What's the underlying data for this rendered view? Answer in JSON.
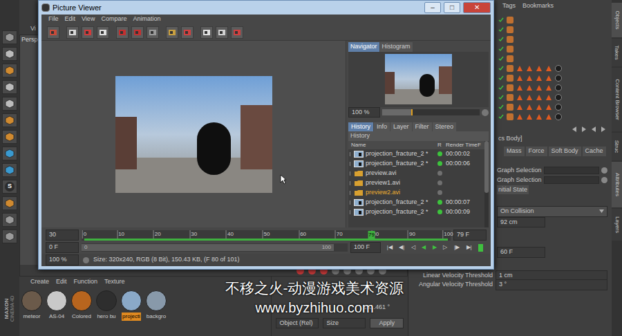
{
  "viewer": {
    "title": "Picture Viewer",
    "controls": [
      "–",
      "□",
      "✕"
    ],
    "menu": [
      "File",
      "Edit",
      "View",
      "Compare",
      "Animation"
    ],
    "nav_tabs": [
      {
        "label": "Navigator",
        "selected": true
      },
      {
        "label": "Histogram",
        "selected": false
      }
    ],
    "nav_zoom": "100 %",
    "nav_zoom_level": 0.3,
    "panel_tabs": [
      {
        "label": "History",
        "selected": true
      },
      {
        "label": "Info",
        "selected": false
      },
      {
        "label": "Layer",
        "selected": false
      },
      {
        "label": "Filter",
        "selected": false
      },
      {
        "label": "Stereo",
        "selected": false
      }
    ],
    "history_title": "History",
    "columns": [
      "Name",
      "R",
      "Render Time",
      "F"
    ],
    "rows": [
      {
        "kind": "render",
        "name": "projection_fracture_2 *",
        "time": "00:00:02",
        "color": "#3cc33c",
        "selected": false
      },
      {
        "kind": "render",
        "name": "projection_fracture_2 *",
        "time": "00:00:06",
        "color": "#3cc33c",
        "selected": false
      },
      {
        "kind": "folder",
        "name": "preview.avi",
        "time": "",
        "color": "#707070",
        "selected": false
      },
      {
        "kind": "folder",
        "name": "preview1.avi",
        "time": "",
        "color": "#707070",
        "selected": false
      },
      {
        "kind": "folder",
        "name": "preview2.avi",
        "time": "",
        "color": "#707070",
        "selected": true
      },
      {
        "kind": "render",
        "name": "projection_fracture_2 *",
        "time": "00:00:07",
        "color": "#3cc33c",
        "selected": false
      },
      {
        "kind": "render",
        "name": "projection_fracture_2 *",
        "time": "00:00:09",
        "color": "#3cc33c",
        "selected": false
      }
    ],
    "timeline": {
      "start": "30",
      "ticks": [
        "0",
        "10",
        "20",
        "30",
        "40",
        "50",
        "60",
        "70",
        "80",
        "90",
        "100"
      ],
      "current": "79",
      "current_level": 0.79,
      "end": "79 F",
      "range_start": "0 F",
      "scroll_start": "0",
      "scroll_end": "100",
      "range_end": "100 F",
      "controls": [
        "|◀",
        "◀|",
        "◁",
        "◀",
        "▶",
        "▷",
        "|▶",
        "▶|"
      ]
    },
    "status": {
      "zoom": "100 %",
      "info": "Size: 320x240, RGB (8 Bit), 150.43 KB, (F 80 of 101)"
    }
  },
  "editor": {
    "viewport": {
      "menu": "Vi",
      "view": "Perspe"
    },
    "left_toolbar": {
      "glyph": "S",
      "brand": [
        "MAXON",
        "CINEMA 4D"
      ]
    },
    "object_manager": {
      "menu": [
        "Tags",
        "Bookmarks"
      ],
      "rows": [
        {
          "checked": true,
          "tags": 0
        },
        {
          "checked": true,
          "tags": 0
        },
        {
          "checked": true,
          "tags": 0
        },
        {
          "checked": true,
          "tags": 0
        },
        {
          "checked": true,
          "tags": 0
        },
        {
          "checked": true,
          "tags": 4
        },
        {
          "checked": true,
          "tags": 4
        },
        {
          "checked": true,
          "tags": 4
        },
        {
          "checked": true,
          "tags": 4
        },
        {
          "checked": true,
          "tags": 4
        },
        {
          "checked": true,
          "tags": 4
        }
      ]
    },
    "attributes": {
      "title": "cs Body]",
      "tabs": [
        {
          "label": "Mass",
          "selected": false
        },
        {
          "label": "Force",
          "selected": false
        },
        {
          "label": "Soft Body",
          "selected": false
        },
        {
          "label": "Cache",
          "selected": false
        }
      ],
      "selections": [
        "Graph Selection",
        "Graph Selection"
      ],
      "button": "nitial State",
      "dropdown": "On Collision",
      "field_a": "92 cm",
      "field_b": "60 F",
      "thresholds": [
        {
          "label": "Linear Velocity Threshold",
          "value": "1 cm"
        },
        {
          "label": "Angular Velocity Threshold",
          "value": "3 °"
        }
      ]
    },
    "side_tabs": [
      "Objects",
      "Takes",
      "Content Browser",
      "Struc",
      "Attributes",
      "Layers"
    ],
    "materials": {
      "menu": [
        "Create",
        "Edit",
        "Function",
        "Texture"
      ],
      "items": [
        {
          "name": "meteor",
          "color": "#6b5a4a",
          "selected": false
        },
        {
          "name": "AS-04",
          "color": "#c9c9c9",
          "selected": false
        },
        {
          "name": "Colored",
          "color": "#b8651e",
          "selected": false
        },
        {
          "name": "hero bu",
          "color": "#2e2e2e",
          "selected": false
        },
        {
          "name": "projecti",
          "color": "#8aa9c8",
          "selected": true
        },
        {
          "name": "backgro",
          "color": "#8899aa",
          "selected": false
        }
      ]
    },
    "coordinates": {
      "value": "132.461 °",
      "mode": "Object (Rel)",
      "size": "Size",
      "apply": "Apply"
    }
  },
  "watermark": [
    "不移之火-动漫游戏美术资源",
    "www.byzhihuo.com"
  ]
}
